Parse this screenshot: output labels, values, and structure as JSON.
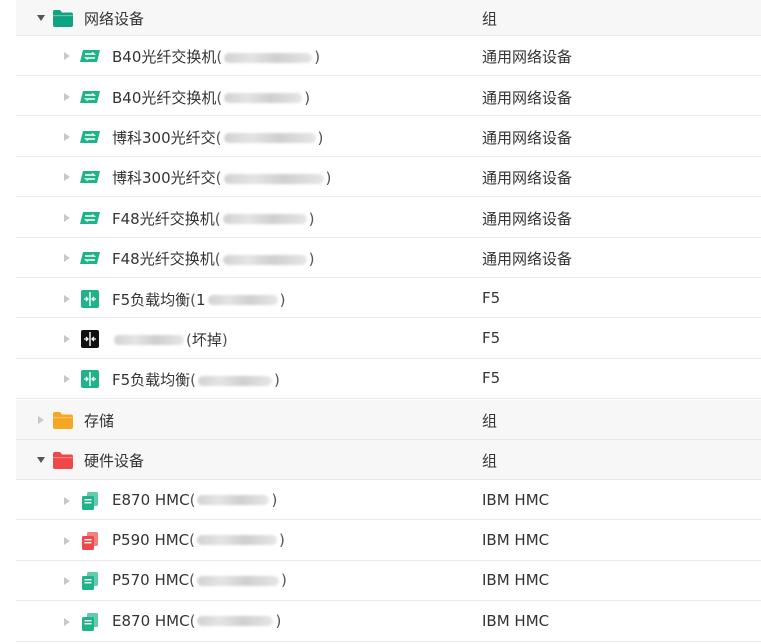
{
  "tree": {
    "groups": [
      {
        "label": "网络设备",
        "type": "组",
        "folder_color": "#10a37f",
        "expanded": true,
        "items": [
          {
            "label": "B40光纤交换机",
            "ip_shown": "",
            "suffix": "",
            "type": "通用网络设备",
            "icon": "network-switch-icon",
            "icon_color": "#1fb38a"
          },
          {
            "label": "B40光纤交换机",
            "ip_shown": "",
            "suffix": "",
            "type": "通用网络设备",
            "icon": "network-switch-icon",
            "icon_color": "#1fb38a"
          },
          {
            "label": "博科300光纤交",
            "ip_shown": "",
            "suffix": "",
            "type": "通用网络设备",
            "icon": "network-switch-icon",
            "icon_color": "#1fb38a"
          },
          {
            "label": "博科300光纤交",
            "ip_shown": "",
            "suffix": "",
            "type": "通用网络设备",
            "icon": "network-switch-icon",
            "icon_color": "#1fb38a"
          },
          {
            "label": "F48光纤交换机",
            "ip_shown": "",
            "suffix": "",
            "type": "通用网络设备",
            "icon": "network-switch-icon",
            "icon_color": "#1fb38a"
          },
          {
            "label": "F48光纤交换机",
            "ip_shown": "",
            "suffix": "",
            "type": "通用网络设备",
            "icon": "network-switch-icon",
            "icon_color": "#1fb38a"
          },
          {
            "label": "F5负载均衡",
            "ip_shown": "1",
            "suffix": "",
            "type": "F5",
            "icon": "load-balancer-icon",
            "icon_color": "#1fb38a"
          },
          {
            "label": "",
            "ip_shown": "",
            "suffix": "坏掉",
            "type": "F5",
            "icon": "load-balancer-icon",
            "icon_color": "#111111"
          },
          {
            "label": "F5负载均衡",
            "ip_shown": "",
            "suffix": "",
            "type": "F5",
            "icon": "load-balancer-icon",
            "icon_color": "#1fb38a"
          }
        ]
      },
      {
        "label": "存储",
        "type": "组",
        "folder_color": "#f6a623",
        "expanded": false,
        "items": []
      },
      {
        "label": "硬件设备",
        "type": "组",
        "folder_color": "#f04848",
        "expanded": true,
        "items": [
          {
            "label": "E870 HMC",
            "ip_shown": "",
            "suffix": "",
            "type": "IBM HMC",
            "icon": "hmc-server-icon",
            "icon_color": "#1fb38a"
          },
          {
            "label": "P590 HMC",
            "ip_shown": "",
            "suffix": "",
            "type": "IBM HMC",
            "icon": "hmc-server-icon",
            "icon_color": "#f04848"
          },
          {
            "label": "P570 HMC",
            "ip_shown": "",
            "suffix": "",
            "type": "IBM HMC",
            "icon": "hmc-server-icon",
            "icon_color": "#1fb38a"
          },
          {
            "label": "E870 HMC",
            "ip_shown": "",
            "suffix": "",
            "type": "IBM HMC",
            "icon": "hmc-server-icon",
            "icon_color": "#1fb38a"
          }
        ]
      }
    ]
  }
}
